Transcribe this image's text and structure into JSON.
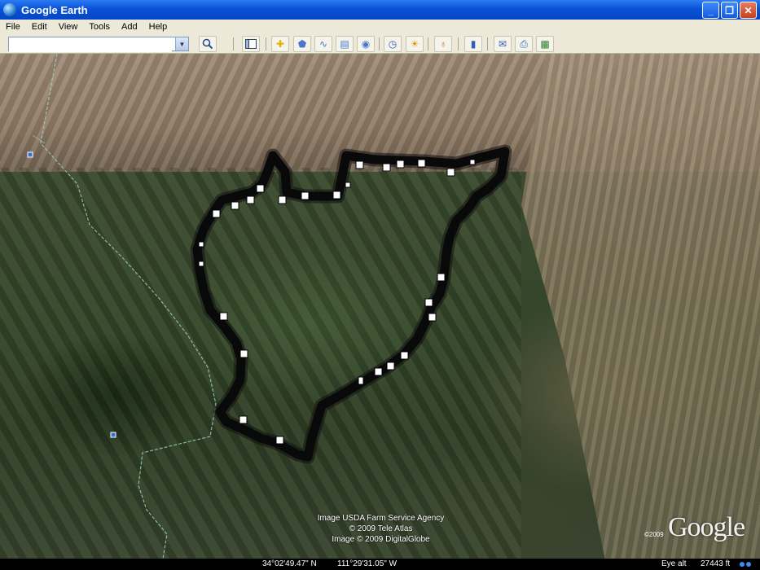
{
  "window": {
    "title": "Google Earth"
  },
  "menu": [
    "File",
    "Edit",
    "View",
    "Tools",
    "Add",
    "Help"
  ],
  "search": {
    "value": "",
    "placeholder": ""
  },
  "toolbar": {
    "icons": [
      "search-icon",
      "sidebar-icon",
      "placemark-icon",
      "polygon-icon",
      "path-icon",
      "overlay-icon",
      "tour-icon",
      "historical-imagery-icon",
      "sunlight-icon",
      "planets-icon",
      "ruler-icon",
      "email-icon",
      "print-icon",
      "google-maps-icon"
    ]
  },
  "map": {
    "attribution": [
      "Image USDA Farm Service Agency",
      "© 2009 Tele Atlas",
      "Image © 2009 DigitalGlobe"
    ],
    "logo": "Google",
    "logo_year": "©2009",
    "colors": {
      "track": "#000000",
      "boundary": "#9fd6c8",
      "marker_fill": "#ffffff"
    }
  },
  "status": {
    "lat": "34°02'49.47\" N",
    "lon": "111°29'31.05\" W",
    "eye_alt_label": "Eye alt",
    "eye_alt_value": "27443 ft"
  }
}
